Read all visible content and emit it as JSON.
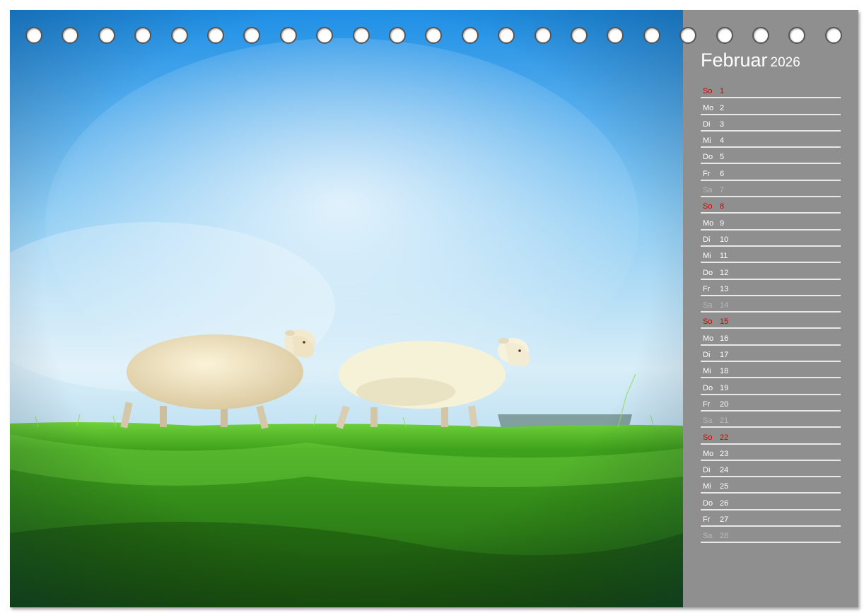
{
  "calendar": {
    "month": "Februar",
    "year": "2026",
    "days": [
      {
        "wd": "So",
        "d": "1",
        "kind": "sun"
      },
      {
        "wd": "Mo",
        "d": "2",
        "kind": "week"
      },
      {
        "wd": "Di",
        "d": "3",
        "kind": "week"
      },
      {
        "wd": "Mi",
        "d": "4",
        "kind": "week"
      },
      {
        "wd": "Do",
        "d": "5",
        "kind": "week"
      },
      {
        "wd": "Fr",
        "d": "6",
        "kind": "week"
      },
      {
        "wd": "Sa",
        "d": "7",
        "kind": "sat"
      },
      {
        "wd": "So",
        "d": "8",
        "kind": "sun"
      },
      {
        "wd": "Mo",
        "d": "9",
        "kind": "week"
      },
      {
        "wd": "Di",
        "d": "10",
        "kind": "week"
      },
      {
        "wd": "Mi",
        "d": "11",
        "kind": "week"
      },
      {
        "wd": "Do",
        "d": "12",
        "kind": "week"
      },
      {
        "wd": "Fr",
        "d": "13",
        "kind": "week"
      },
      {
        "wd": "Sa",
        "d": "14",
        "kind": "sat"
      },
      {
        "wd": "So",
        "d": "15",
        "kind": "sun"
      },
      {
        "wd": "Mo",
        "d": "16",
        "kind": "week"
      },
      {
        "wd": "Di",
        "d": "17",
        "kind": "week"
      },
      {
        "wd": "Mi",
        "d": "18",
        "kind": "week"
      },
      {
        "wd": "Do",
        "d": "19",
        "kind": "week"
      },
      {
        "wd": "Fr",
        "d": "20",
        "kind": "week"
      },
      {
        "wd": "Sa",
        "d": "21",
        "kind": "sat"
      },
      {
        "wd": "So",
        "d": "22",
        "kind": "sun"
      },
      {
        "wd": "Mo",
        "d": "23",
        "kind": "week"
      },
      {
        "wd": "Di",
        "d": "24",
        "kind": "week"
      },
      {
        "wd": "Mi",
        "d": "25",
        "kind": "week"
      },
      {
        "wd": "Do",
        "d": "26",
        "kind": "week"
      },
      {
        "wd": "Fr",
        "d": "27",
        "kind": "week"
      },
      {
        "wd": "Sa",
        "d": "28",
        "kind": "sat"
      }
    ]
  },
  "colors": {
    "panel": "#8f8f8f",
    "sunday": "#d40000",
    "saturday": "#b9b9b9",
    "weekday": "#ffffff",
    "sky_top": "#1f93e8",
    "grass": "#3fa21c"
  },
  "photo": {
    "subject_icons": [
      "sheep-icon",
      "sheep-icon"
    ]
  },
  "binding": {
    "ring_count": 23
  }
}
